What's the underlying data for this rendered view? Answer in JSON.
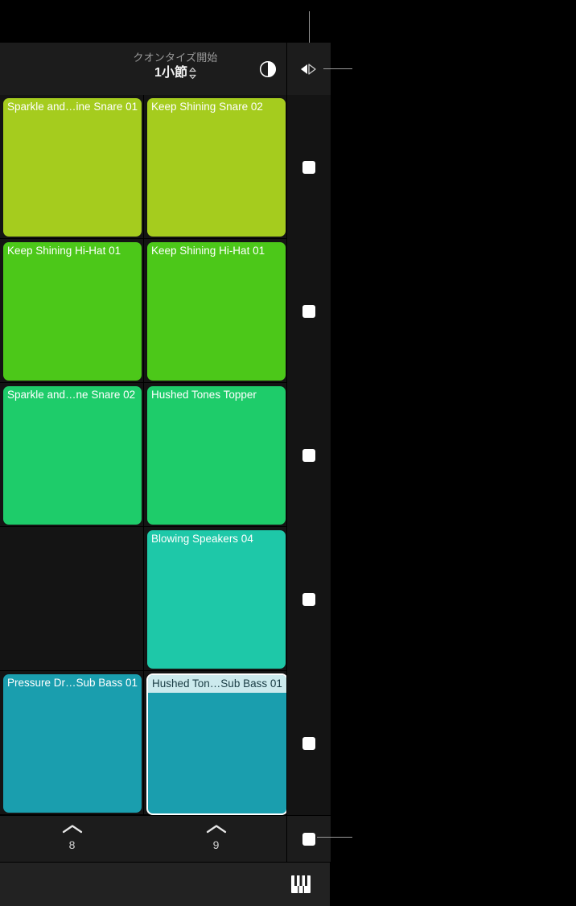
{
  "header": {
    "quantize_label": "クオンタイズ開始",
    "quantize_value": "1小節",
    "stepper_icon": "up-down-stepper-icon",
    "contrast_icon": "half-circle-contrast-icon",
    "playhead_icon": "playhead-triangles-icon"
  },
  "colors": {
    "row1": "#a5cc1e",
    "row2": "#4cc819",
    "row3": "#1ecc6a",
    "row4": "#1ec8a8",
    "row5": "#1a9eae",
    "background": "#141414",
    "panel_header": "#1c1c1c",
    "bottom_bar": "#222222",
    "stop_button": "#ffffff",
    "selection": "#ffffff"
  },
  "grid": {
    "stop_button_label": "stop",
    "rows": [
      {
        "color": "#a5cc1e",
        "cells": [
          {
            "title": "Sparkle and…ine Snare 01",
            "art": "spikes4",
            "playing": false,
            "selected": false,
            "empty": false
          },
          {
            "title": "Keep Shining Snare 02",
            "art": "spikes6",
            "playing": true,
            "progress": 0.22,
            "selected": false,
            "empty": false
          }
        ]
      },
      {
        "color": "#4cc819",
        "cells": [
          {
            "title": "Keep Shining Hi-Hat 01",
            "art": "dense",
            "playing": false,
            "selected": false,
            "empty": false
          },
          {
            "title": "Keep Shining Hi-Hat 01",
            "art": "dense",
            "playing": true,
            "progress": 0.25,
            "selected": false,
            "empty": false
          }
        ]
      },
      {
        "color": "#1ecc6a",
        "cells": [
          {
            "title": "Sparkle and…ne Snare 02",
            "art": "thin2",
            "playing": false,
            "selected": false,
            "empty": false
          },
          {
            "title": "Hushed Tones Topper",
            "art": "ring",
            "playing": true,
            "progress": 0.33,
            "selected": false,
            "empty": false
          }
        ]
      },
      {
        "color": "#1ec8a8",
        "cells": [
          {
            "title": "",
            "art": "none",
            "playing": false,
            "selected": false,
            "empty": true
          },
          {
            "title": "Blowing Speakers 04",
            "art": "sparse",
            "playing": true,
            "progress": 0.13,
            "selected": false,
            "empty": false
          }
        ]
      },
      {
        "color": "#1a9eae",
        "cells": [
          {
            "title": "Pressure Dr…Sub Bass 01",
            "art": "bass",
            "playing": false,
            "selected": false,
            "empty": false
          },
          {
            "title": "Hushed Ton…Sub Bass 01",
            "art": "bass",
            "playing": true,
            "progress": 0.18,
            "selected": true,
            "empty": false
          }
        ]
      }
    ]
  },
  "footer": {
    "cells": [
      {
        "number": "8",
        "chevron_icon": "chevron-up-icon"
      },
      {
        "number": "9",
        "chevron_icon": "chevron-up-icon"
      }
    ],
    "stop_all_label": "stop-all"
  },
  "bottom_bar": {
    "keyboard_icon": "piano-keyboard-icon"
  }
}
